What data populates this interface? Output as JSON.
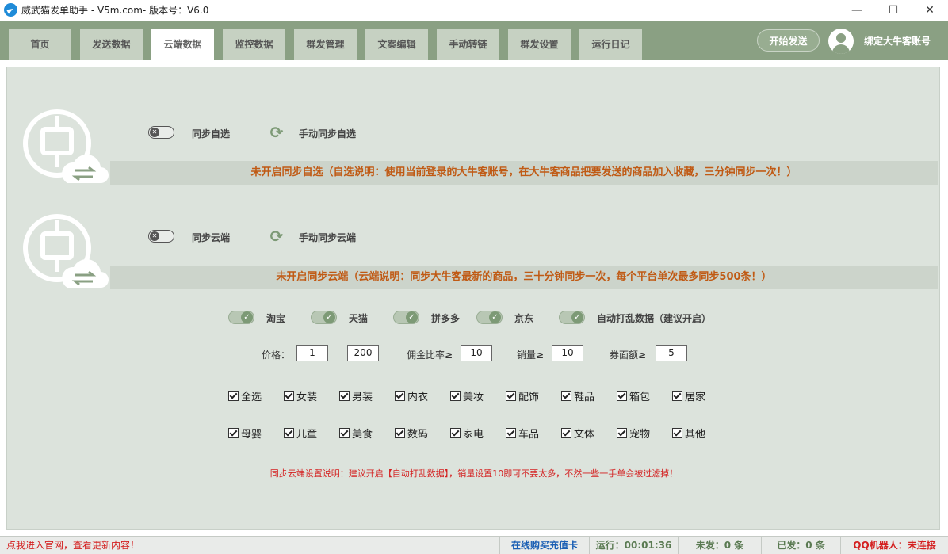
{
  "window": {
    "title": "威武猫发单助手 - V5m.com- 版本号：V6.0",
    "min_label": "—",
    "max_label": "☐",
    "close_label": "✕"
  },
  "nav": {
    "tabs": [
      {
        "label": "首页"
      },
      {
        "label": "发送数据"
      },
      {
        "label": "云端数据"
      },
      {
        "label": "监控数据"
      },
      {
        "label": "群发管理"
      },
      {
        "label": "文案编辑"
      },
      {
        "label": "手动转链"
      },
      {
        "label": "群发设置"
      },
      {
        "label": "运行日记"
      }
    ],
    "active_tab": "云端数据",
    "start_button": "开始发送",
    "bind_account": "绑定大牛客账号"
  },
  "sync_self": {
    "toggle_label": "同步自选",
    "manual_label": "手动同步自选",
    "banner": "未开启同步自选（自选说明：使用当前登录的大牛客账号，在大牛客商品把要发送的商品加入收藏，三分钟同步一次！）"
  },
  "sync_cloud": {
    "toggle_label": "同步云端",
    "manual_label": "手动同步云端",
    "banner": "未开启同步云端（云端说明：同步大牛客最新的商品，三十分钟同步一次，每个平台单次最多同步500条！）"
  },
  "platforms": [
    {
      "label": "淘宝",
      "on": true
    },
    {
      "label": "天猫",
      "on": true
    },
    {
      "label": "拼多多",
      "on": true
    },
    {
      "label": "京东",
      "on": true
    },
    {
      "label": "自动打乱数据（建议开启）",
      "on": true
    }
  ],
  "filters": {
    "price_label": "价格：",
    "price_min": "1",
    "price_sep": "—",
    "price_max": "200",
    "commission_label": "佣金比率≥",
    "commission": "10",
    "sales_label": "销量≥",
    "sales": "10",
    "coupon_label": "券面额≥",
    "coupon": "5"
  },
  "categories_row1": [
    "全选",
    "女装",
    "男装",
    "内衣",
    "美妆",
    "配饰",
    "鞋品",
    "箱包",
    "居家"
  ],
  "categories_row2": [
    "母婴",
    "儿童",
    "美食",
    "数码",
    "家电",
    "车品",
    "文体",
    "宠物",
    "其他"
  ],
  "note": "同步云端设置说明：建议开启【自动打乱数据】，销量设置10即可不要太多，不然一些一手单会被过滤掉！",
  "status": {
    "website_link": "点我进入官网，查看更新内容！",
    "buy_card": "在线购买充值卡",
    "running": "运行：00:01:36",
    "unsent": "未发：0 条",
    "sent": "已发：0 条",
    "qq_robot": "QQ机器人：未连接"
  },
  "colors": {
    "header_bg": "#8aa083",
    "content_bg": "#dce3dc",
    "banner_text": "#c05a14",
    "note_text": "#d42020",
    "link_blue": "#1a5fb4"
  },
  "icons": [
    "telegram-app-icon",
    "cloud-sync-icon",
    "refresh-icon",
    "user-avatar-icon",
    "toggle-switch-icon",
    "checkbox-icon"
  ]
}
